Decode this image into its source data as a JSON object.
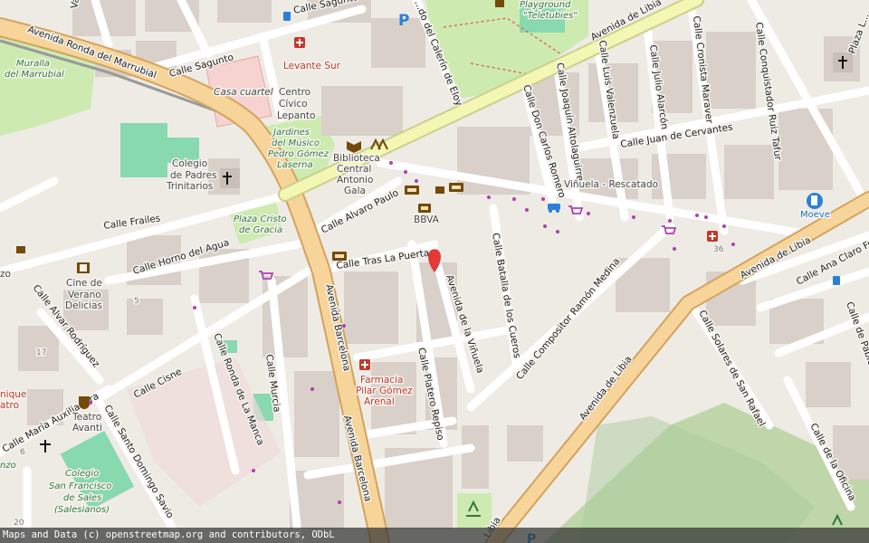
{
  "colors": {
    "land": "#f2efe9",
    "building": "#d9d0c9",
    "primary_road": "#f7d49a",
    "primary_casing": "#d2a35e",
    "minor_road": "#ffffff",
    "park": "#cdebb0",
    "pitch": "#88d8b0",
    "marker": "#e53935",
    "poi_red": "#c0392b",
    "poi_blue": "#1f6fb8",
    "poi_brown": "#734a08"
  },
  "roads": {
    "ronda_marrubial": "Avenida Ronda del Marrubial",
    "sagunto": "Calle Sagunto",
    "calerin": "...do del Calerín de Eloy",
    "barcelona_1": "Avenida Barcelona",
    "barcelona_2": "Avenida Barcelona",
    "libia_1": "Avenida de Libia",
    "libia_2": "Avenida de Libia",
    "libia_3": "Libia",
    "frailes": "Calle Frailes",
    "horno_agua": "Calle Horno del Agua",
    "alvaro_paulo": "Calle Alvaro Paulo",
    "tras_puerta": "Calle Tras La Puerta",
    "vinuela": "Avenida de la Viñuela",
    "platero_repiso": "Calle Platero Repiso",
    "murcia": "Calle Murcia",
    "ronda_mancha": "Calle Ronda de La Manca",
    "cisne": "Calle Cisne",
    "alvar_rodriguez": "Calle Alvar Rodríguez",
    "maria_auxiliadora": "Calle María Auxiliadora",
    "santo_domingo": "Calle Santo Domingo Savio",
    "batalla_cueros": "Calle Batalla de los Cueros",
    "compositor": "Calle Compositor Ramón Medina",
    "don_carlos": "Calle Don Carlos Romero",
    "joaquin": "Calle Joaquín Altolaguirre",
    "luis_valenzuela": "Calle Luis Valenzuela",
    "julio_alarcon": "Calle Julio Alarcón",
    "cronista": "Calle Cronista Maraver",
    "cervantes": "Calle Juan de Cervantes",
    "conquistador": "Calle Conquistador Ruiz Tafur",
    "ana_claro": "Calle Ana Claro Fr...",
    "pablo": "Calle de Pablo...",
    "solares": "Calle Solares de San Rafael",
    "oficina": "Calle de la Oficina",
    "plaza_top": "Plaza L..."
  },
  "places": {
    "levante_sur": "Levante Sur",
    "casa_cuartel": "Casa cuartel",
    "centro_civico": [
      "Centro",
      "Cívico",
      "Lepanto"
    ],
    "jardines": [
      "Jardines",
      "del Músico",
      "Pedro Gómez",
      "Laserna"
    ],
    "biblioteca": [
      "Biblioteca",
      "Central",
      "Antonio",
      "Gala"
    ],
    "colegio_padres": [
      "Colegio",
      "de Padres",
      "Trinitarios"
    ],
    "plaza_cristo": [
      "Plaza Cristo",
      "de Gracia"
    ],
    "bbva": "BBVA",
    "vinuela_rescatado": "Viñuela - Rescatado",
    "cine": [
      "Cine de",
      "Verano",
      "Delicias"
    ],
    "farmacia": [
      "Farmacia",
      "Pilar Gómez",
      "Arenal"
    ],
    "teatro": [
      "Teatro",
      "Avanti"
    ],
    "colegio_sales": [
      "Colegio",
      "San Francisco",
      "de Sales",
      "(Salesianos)"
    ],
    "muralla": [
      "Muralla",
      "del Marrubial"
    ],
    "playground": [
      "Playground",
      "\"Teletubies\""
    ],
    "moeve": "Moeve",
    "num_36": "36",
    "num_17": "17",
    "num_5": "5",
    "num_20": "20",
    "num_6": "6",
    "edge_zo": "zo",
    "edge_nzo": "nzo",
    "edge_nique": [
      "nique",
      "atro"
    ],
    "edge_va": "Va"
  },
  "icons": [
    "hospital-cross-icon",
    "parking-icon",
    "library-icon",
    "church-cross-icon",
    "bank-icon",
    "shopping-cart-icon",
    "cinema-icon",
    "theatre-icon",
    "fuel-icon",
    "car-icon",
    "pharmacy-icon",
    "bus-stop-icon",
    "location-pin-icon"
  ],
  "attribution": "Maps and Data (c) openstreetmap.org and contributors, ODbL"
}
